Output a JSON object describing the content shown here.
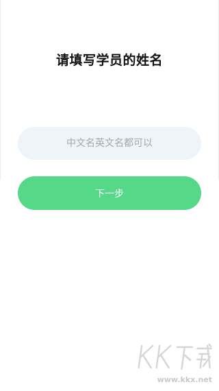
{
  "page": {
    "title": "请填写学员的姓名"
  },
  "name_input": {
    "placeholder": "中文名英文名都可以",
    "value": ""
  },
  "next_button": {
    "label": "下一步"
  },
  "watermark": {
    "logo_text": "KK下载",
    "url": "www.kkx.net"
  },
  "colors": {
    "accent": "#55d887",
    "input_background": "#eff4f9",
    "placeholder": "#a2a7ad",
    "title": "#111111"
  }
}
